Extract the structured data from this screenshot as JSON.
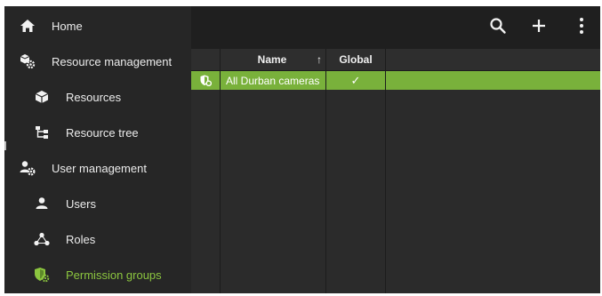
{
  "sidebar": {
    "items": [
      {
        "label": "Home",
        "icon": "home-icon"
      },
      {
        "label": "Resource management",
        "icon": "resource-management-icon"
      },
      {
        "label": "Resources",
        "icon": "cube-icon"
      },
      {
        "label": "Resource tree",
        "icon": "tree-icon"
      },
      {
        "label": "User management",
        "icon": "user-management-icon"
      },
      {
        "label": "Users",
        "icon": "user-icon"
      },
      {
        "label": "Roles",
        "icon": "roles-icon"
      },
      {
        "label": "Permission groups",
        "icon": "permission-groups-icon"
      }
    ],
    "active_index": 7
  },
  "toolbar": {
    "buttons": [
      "search-icon",
      "plus-icon",
      "more-vertical-icon"
    ]
  },
  "table": {
    "columns": {
      "name": "Name",
      "name_sort": "↑",
      "global": "Global"
    },
    "rows": [
      {
        "name": "All Durban cameras",
        "global": "✓",
        "selected": true
      }
    ]
  },
  "colors": {
    "accent": "#8cc63f",
    "selected_row": "#79b13b",
    "sidebar_bg": "#262626",
    "toolbar_bg": "#1f1f1f"
  }
}
